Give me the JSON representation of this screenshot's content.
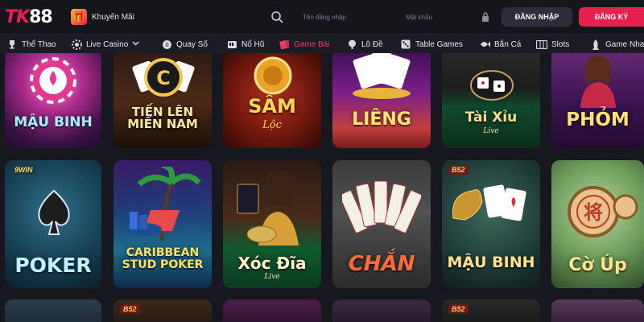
{
  "header": {
    "logo_mark": "TK",
    "logo_num": "88",
    "promo_label": "Khuyến Mãi",
    "username_placeholder": "Tên đăng nhập",
    "password_placeholder": "Mật khẩu",
    "login_label": "ĐĂNG NHẬP",
    "register_label": "ĐĂNG KÝ",
    "accent": "#e8204f"
  },
  "nav": {
    "items": [
      {
        "label": "Thể Thao",
        "icon": "trophy-icon"
      },
      {
        "label": "Live Casino",
        "icon": "chip-icon"
      },
      {
        "label": "Quay Số",
        "icon": "ball-icon"
      },
      {
        "label": "Nổ Hũ",
        "icon": "slot-icon"
      },
      {
        "label": "Game Bài",
        "icon": "cards-icon"
      },
      {
        "label": "Lô Đề",
        "icon": "lottery-icon"
      },
      {
        "label": "Table Games",
        "icon": "dice-icon"
      },
      {
        "label": "Bắn Cá",
        "icon": "fish-icon"
      },
      {
        "label": "Slots",
        "icon": "slots-icon"
      },
      {
        "label": "Game Nhanh",
        "icon": "rocket-icon"
      }
    ],
    "active": "Game Bài"
  },
  "games_row1": [
    {
      "title": "MẬU BINH",
      "sub": ""
    },
    {
      "title": "TIẾN LÊN MIỀN NAM",
      "sub": ""
    },
    {
      "title": "SÂM",
      "sub": "Lộc"
    },
    {
      "title": "LIÊNG",
      "sub": ""
    },
    {
      "title": "Tài Xỉu",
      "sub": "Live"
    },
    {
      "title": "PHỎM",
      "sub": ""
    }
  ],
  "games_row2": [
    {
      "title": "POKER",
      "sub": "",
      "badge": "9WIN"
    },
    {
      "title": "CARIBBEAN STUD POKER",
      "sub": "",
      "badge": ""
    },
    {
      "title": "Xóc Đĩa",
      "sub": "Live",
      "badge": ""
    },
    {
      "title": "CHẮN",
      "sub": "",
      "badge": ""
    },
    {
      "title": "MẬU BINH",
      "sub": "",
      "badge": "B52"
    },
    {
      "title": "Cờ Úp",
      "sub": "",
      "badge": ""
    }
  ],
  "row3_badges": [
    "",
    "B52",
    "",
    "",
    "B52",
    ""
  ]
}
